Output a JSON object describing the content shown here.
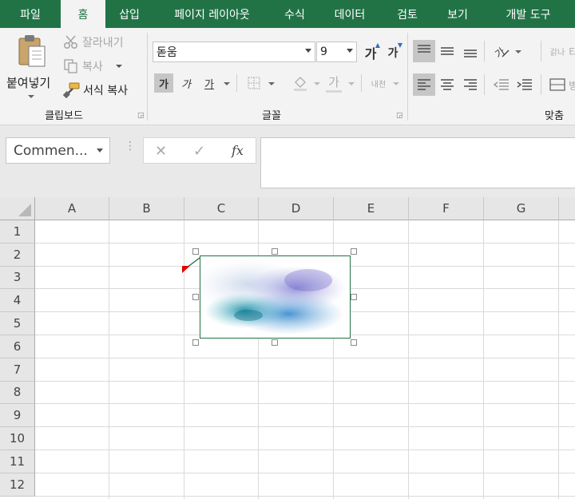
{
  "tabs": [
    "파일",
    "홈",
    "삽입",
    "페이지 레이아웃",
    "수식",
    "데이터",
    "검토",
    "보기",
    "개발 도구"
  ],
  "active_tab": "홈",
  "clipboard": {
    "paste_label": "붙여넣기",
    "cut_label": "잘라내기",
    "copy_label": "복사",
    "format_painter_label": "서식 복사",
    "group_label": "클립보드"
  },
  "font": {
    "font_name": "돋움",
    "font_size": "9",
    "increase_label": "가",
    "decrease_label": "가",
    "bold_label": "가",
    "italic_label": "가",
    "underline_label": "가",
    "font_color_label": "가",
    "phonetic_label": "내천",
    "group_label": "글꼴"
  },
  "alignment": {
    "wrap_label": "갉나",
    "group_label": "맞춤"
  },
  "formula_bar": {
    "name_box": "Commen...",
    "cancel_glyph": "✕",
    "enter_glyph": "✓",
    "fx_label": "fx",
    "formula_value": ""
  },
  "columns": [
    "A",
    "B",
    "C",
    "D",
    "E",
    "F",
    "G"
  ],
  "rows": [
    "1",
    "2",
    "3",
    "4",
    "5",
    "6",
    "7",
    "8",
    "9",
    "10",
    "11",
    "12"
  ],
  "colors": {
    "accent": "#217346",
    "comment_indicator": "#e00000"
  },
  "icons": {
    "paste": "clipboard-paste-icon",
    "cut": "scissors-icon",
    "copy": "copy-icon",
    "format_painter": "paintbrush-icon",
    "borders": "borders-icon",
    "fill_color": "paint-bucket-icon",
    "align_top": "align-top-icon",
    "align_middle": "align-middle-icon",
    "align_bottom": "align-bottom-icon",
    "orientation": "text-orientation-icon",
    "align_left": "align-left-icon",
    "align_center": "align-center-icon",
    "align_right": "align-right-icon",
    "decrease_indent": "decrease-indent-icon",
    "increase_indent": "increase-indent-icon",
    "merge": "merge-cells-icon"
  }
}
